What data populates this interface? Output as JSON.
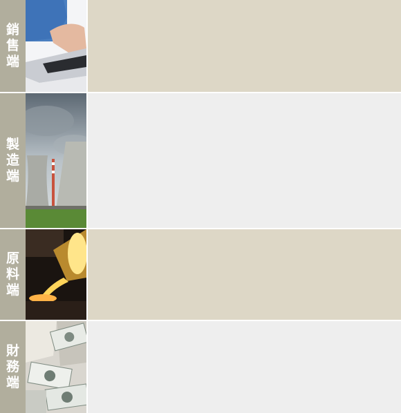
{
  "rows": [
    {
      "label": [
        "銷",
        "售",
        "端"
      ],
      "image": "laptop-typing-photo",
      "panel_color": "#ddd7c6"
    },
    {
      "label": [
        "製",
        "造",
        "端"
      ],
      "image": "cooling-towers-photo",
      "panel_color": "#eeeeee"
    },
    {
      "label": [
        "原",
        "料",
        "端"
      ],
      "image": "molten-metal-pouring-photo",
      "panel_color": "#ddd7c6"
    },
    {
      "label": [
        "財",
        "務",
        "端"
      ],
      "image": "dollar-bills-photo",
      "panel_color": "#eeeeee"
    }
  ]
}
